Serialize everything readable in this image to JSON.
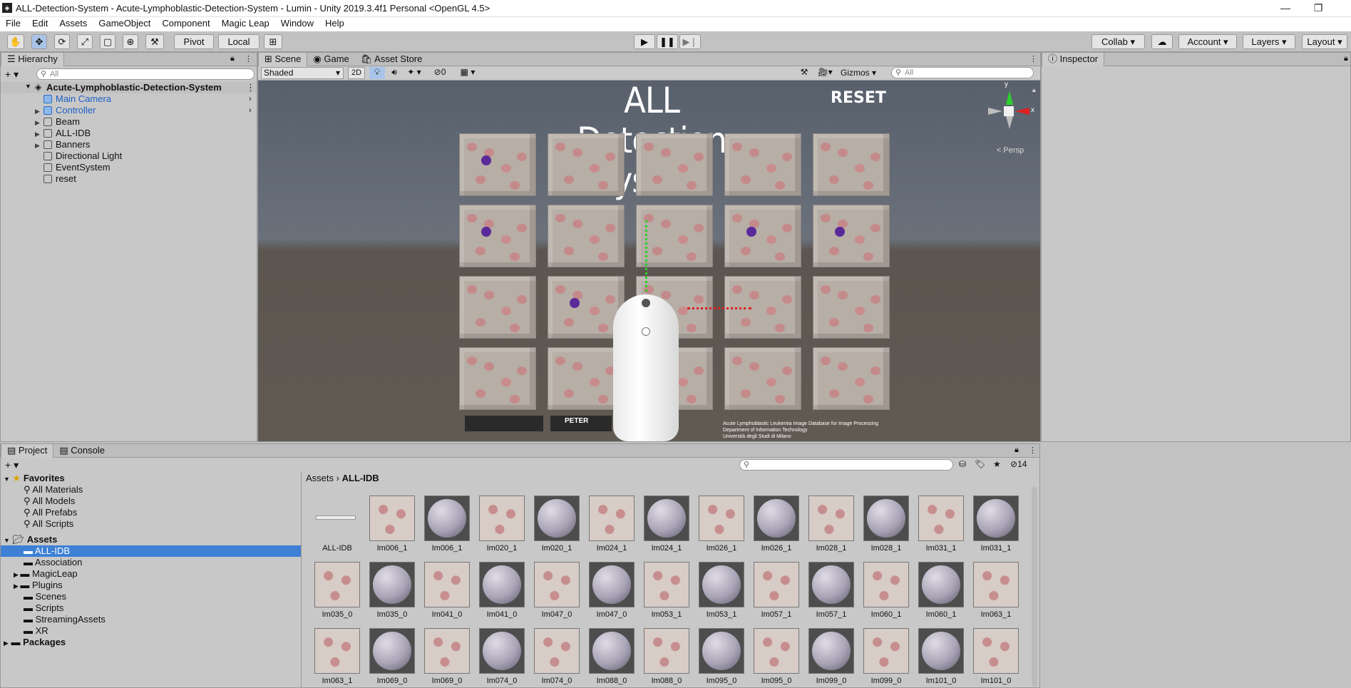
{
  "window": {
    "title": "ALL-Detection-System - Acute-Lymphoblastic-Detection-System - Lumin - Unity 2019.3.4f1 Personal <OpenGL 4.5>",
    "minimize": "—",
    "restore": "❐",
    "close": "✕"
  },
  "menu": [
    "File",
    "Edit",
    "Assets",
    "GameObject",
    "Component",
    "Magic Leap",
    "Window",
    "Help"
  ],
  "toolbar": {
    "pivot": "Pivot",
    "local": "Local",
    "collab": "Collab",
    "account": "Account",
    "layers": "Layers",
    "layout": "Layout"
  },
  "hierarchy": {
    "tab": "Hierarchy",
    "search_placeholder": "All",
    "root": "Acute-Lymphoblastic-Detection-System",
    "items": [
      {
        "label": "Main Camera",
        "blue": true,
        "expandable": false
      },
      {
        "label": "Controller",
        "blue": true,
        "expandable": true
      },
      {
        "label": "Beam",
        "blue": false,
        "expandable": true
      },
      {
        "label": "ALL-IDB",
        "blue": false,
        "expandable": true
      },
      {
        "label": "Banners",
        "blue": false,
        "expandable": true
      },
      {
        "label": "Directional Light",
        "blue": false,
        "expandable": false
      },
      {
        "label": "EventSystem",
        "blue": false,
        "expandable": false
      },
      {
        "label": "reset",
        "blue": false,
        "expandable": false
      }
    ]
  },
  "scene": {
    "tabs": [
      "Scene",
      "Game",
      "Asset Store"
    ],
    "shading": "Shaded",
    "twod": "2D",
    "hidden_count": "0",
    "gizmos": "Gizmos",
    "search_placeholder": "All",
    "persp": "< Persp",
    "gizmo_y": "y",
    "gizmo_x": "x",
    "title": "ALL Detection System",
    "reset": "RESET",
    "footer": [
      "Acute Lymphoblastic Leukemia Image Database for Image Processing",
      "Department of Information Technology",
      "Università degli Studi di Milano"
    ],
    "banner_logo": "PETER"
  },
  "inspector": {
    "tab": "Inspector"
  },
  "project": {
    "tabs": [
      "Project",
      "Console"
    ],
    "hidden_count": "14",
    "favorites_label": "Favorites",
    "favorites": [
      "All Materials",
      "All Models",
      "All Prefabs",
      "All Scripts"
    ],
    "assets_label": "Assets",
    "assets_tree": [
      {
        "label": "ALL-IDB",
        "selected": true,
        "expandable": false
      },
      {
        "label": "Association",
        "selected": false,
        "expandable": false
      },
      {
        "label": "MagicLeap",
        "selected": false,
        "expandable": true
      },
      {
        "label": "Plugins",
        "selected": false,
        "expandable": true
      },
      {
        "label": "Scenes",
        "selected": false,
        "expandable": false
      },
      {
        "label": "Scripts",
        "selected": false,
        "expandable": false
      },
      {
        "label": "StreamingAssets",
        "selected": false,
        "expandable": false
      },
      {
        "label": "XR",
        "selected": false,
        "expandable": false
      }
    ],
    "packages_label": "Packages",
    "breadcrumb": [
      "Assets",
      "ALL-IDB"
    ],
    "grid": [
      [
        "ALL-IDB",
        "Im006_1",
        "Im006_1",
        "Im020_1",
        "Im020_1",
        "Im024_1",
        "Im024_1",
        "Im026_1",
        "Im026_1",
        "Im028_1",
        "Im028_1",
        "Im031_1",
        "Im031_1"
      ],
      [
        "Im035_0",
        "Im035_0",
        "Im041_0",
        "Im041_0",
        "Im047_0",
        "Im047_0",
        "Im053_1",
        "Im053_1",
        "Im057_1",
        "Im057_1",
        "Im060_1",
        "Im060_1",
        "Im063_1"
      ],
      [
        "Im063_1",
        "Im069_0",
        "Im069_0",
        "Im074_0",
        "Im074_0",
        "Im088_0",
        "Im088_0",
        "Im095_0",
        "Im095_0",
        "Im099_0",
        "Im099_0",
        "Im101_0",
        "Im101_0"
      ]
    ]
  }
}
